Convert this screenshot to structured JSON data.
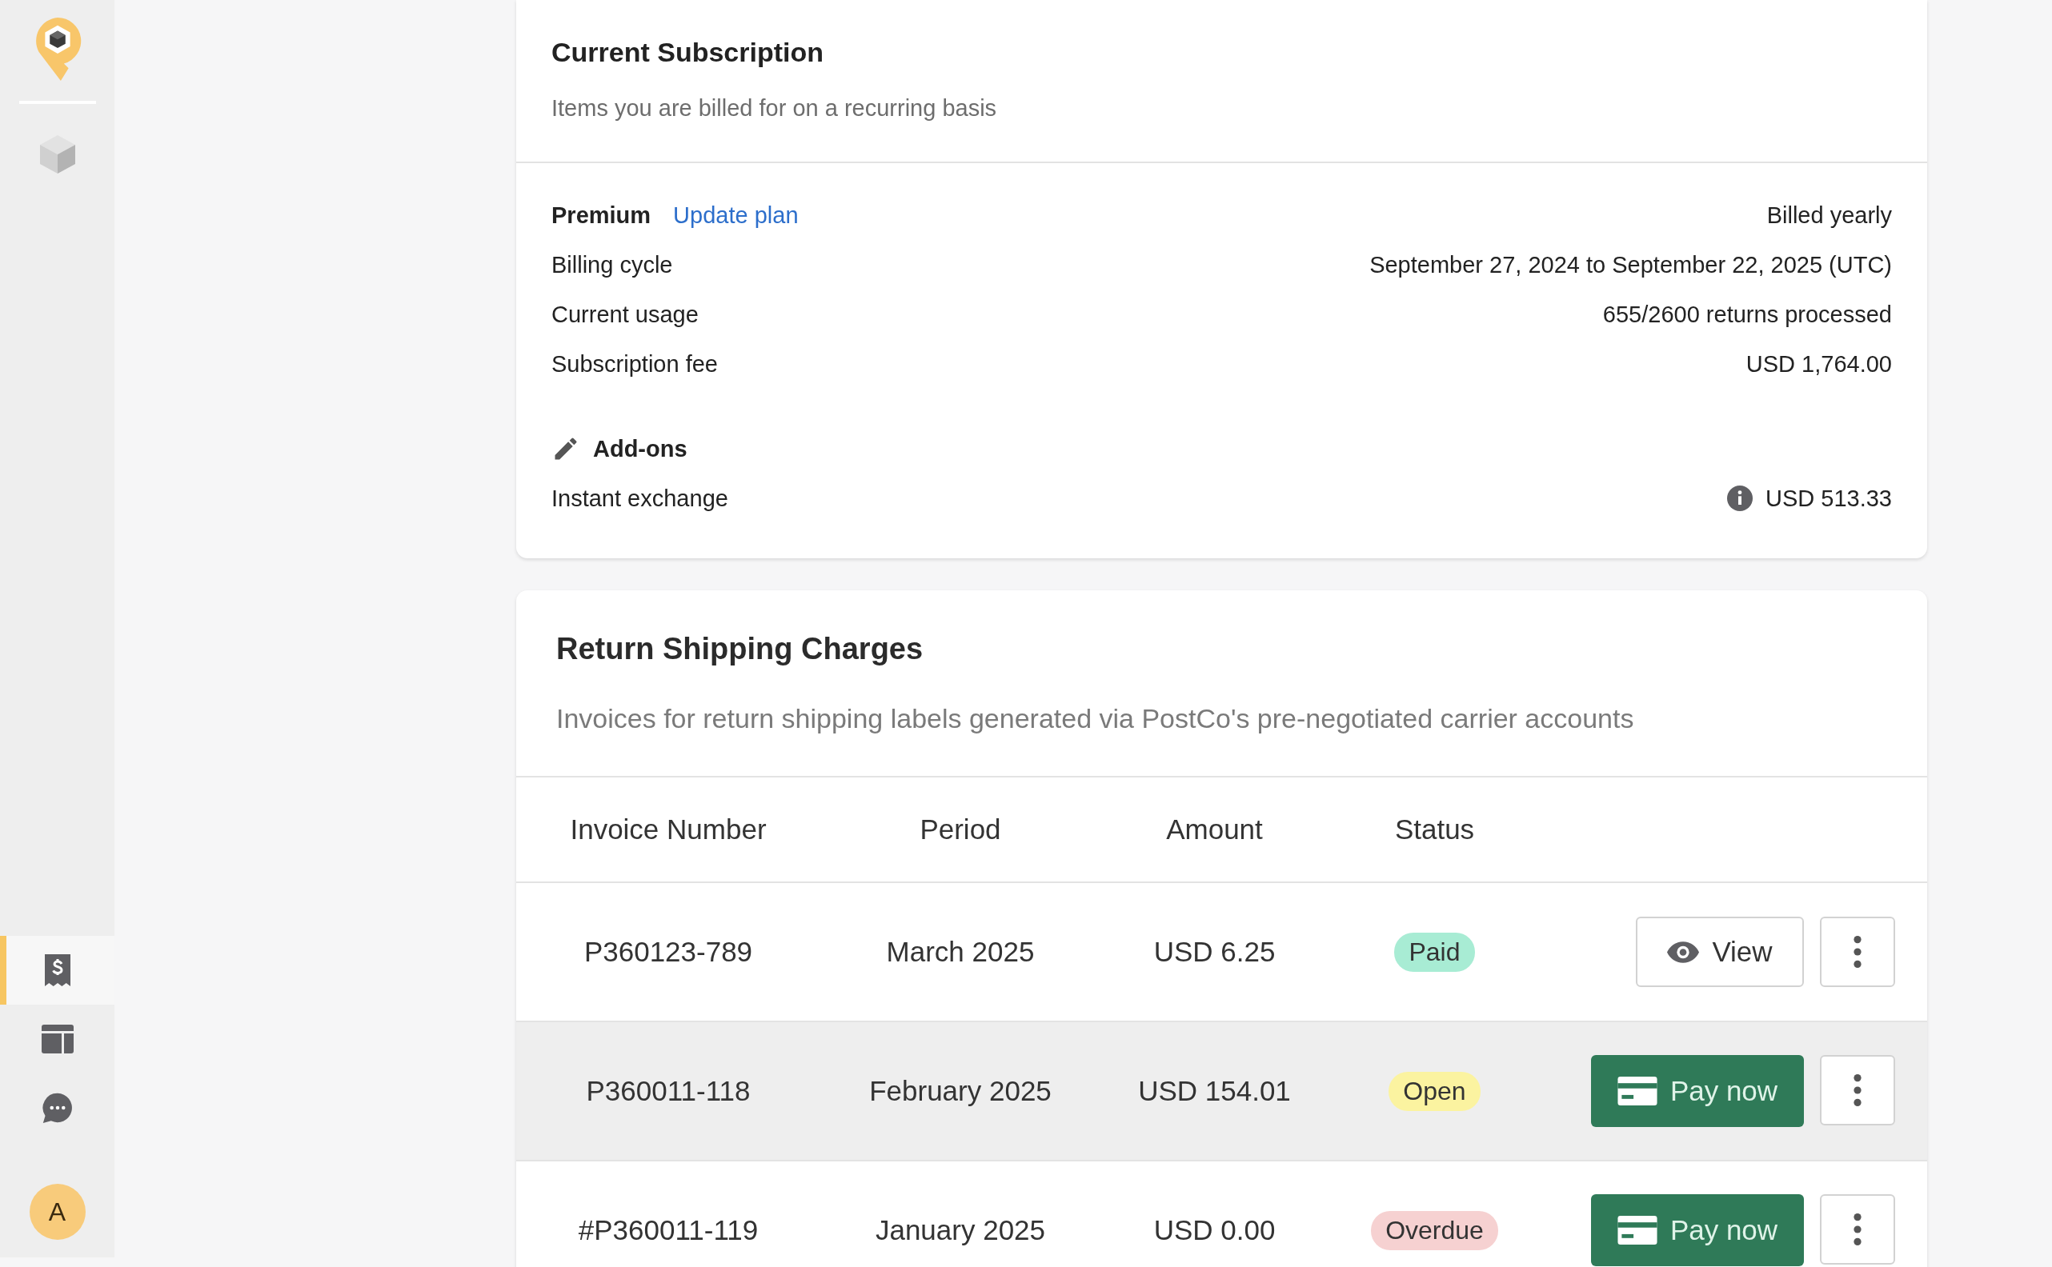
{
  "sidebar": {
    "nav_top": [
      {
        "selected": false
      }
    ],
    "nav_bottom": [
      {
        "selected": true
      },
      {
        "selected": false
      },
      {
        "selected": false
      }
    ],
    "avatar": "A"
  },
  "subscription": {
    "title": "Current Subscription",
    "subtitle": "Items you are billed for on a recurring basis",
    "plan": "Premium",
    "update_link": "Update plan",
    "billing": "Billed yearly",
    "rows": [
      {
        "label": "Billing cycle",
        "value": "September 27, 2024 to September 22, 2025 (UTC)"
      },
      {
        "label": "Current usage",
        "value": "655/2600 returns processed"
      },
      {
        "label": "Subscription fee",
        "value": "USD 1,764.00"
      }
    ],
    "addons_title": "Add-ons",
    "addons": [
      {
        "label": "Instant exchange",
        "value": "USD 513.33"
      }
    ]
  },
  "charges": {
    "title": "Return Shipping Charges",
    "subtitle": "Invoices for return shipping labels generated via PostCo's pre-negotiated carrier accounts",
    "columns": [
      "Invoice Number",
      "Period",
      "Amount",
      "Status"
    ],
    "rows": [
      {
        "invoice": "P360123-789",
        "period": "March 2025",
        "amount": "USD 6.25",
        "status": "Paid",
        "color": "#a8ecd4",
        "hovered": false,
        "action": {
          "kind": "view",
          "label": "View"
        }
      },
      {
        "invoice": "P360011-118",
        "period": "February 2025",
        "amount": "USD 154.01",
        "status": "Open",
        "color": "#fbf3a0",
        "hovered": true,
        "action": {
          "kind": "pay",
          "label": "Pay now"
        }
      },
      {
        "invoice": "#P360011-119",
        "period": "January 2025",
        "amount": "USD 0.00",
        "status": "Overdue",
        "color": "#f6d1d1",
        "hovered": false,
        "action": {
          "kind": "pay",
          "label": "Pay now"
        }
      }
    ]
  }
}
